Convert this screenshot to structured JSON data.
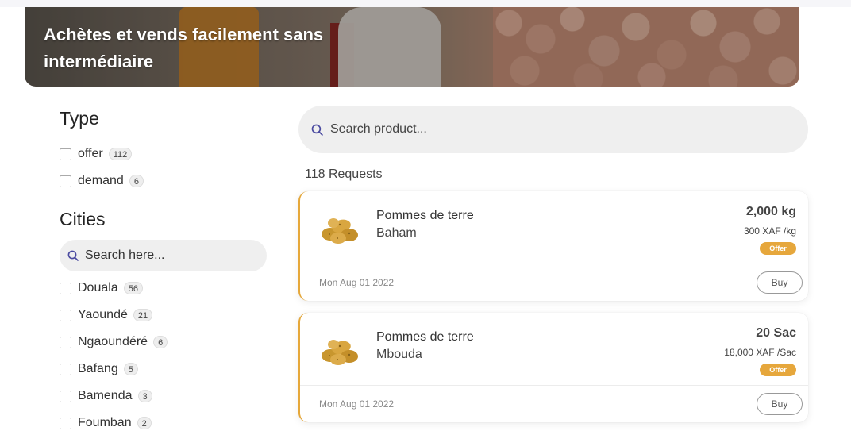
{
  "banner": {
    "title": "Achètes et vends facilement sans intermédiaire"
  },
  "search": {
    "placeholder": "Search product..."
  },
  "filters": {
    "type": {
      "title": "Type",
      "options": [
        {
          "label": "offer",
          "count": "112"
        },
        {
          "label": "demand",
          "count": "6"
        }
      ]
    },
    "cities": {
      "title": "Cities",
      "search_placeholder": "Search here...",
      "options": [
        {
          "label": "Douala",
          "count": "56"
        },
        {
          "label": "Yaoundé",
          "count": "21"
        },
        {
          "label": "Ngaoundéré",
          "count": "6"
        },
        {
          "label": "Bafang",
          "count": "5"
        },
        {
          "label": "Bamenda",
          "count": "3"
        },
        {
          "label": "Foumban",
          "count": "2"
        }
      ]
    }
  },
  "results": {
    "count_label": "118 Requests",
    "items": [
      {
        "product": "Pommes de terre",
        "city": "Baham",
        "quantity": "2,000 kg",
        "price": "300 XAF /kg",
        "badge": "Offer",
        "date": "Mon Aug 01 2022",
        "action": "Buy"
      },
      {
        "product": "Pommes de terre",
        "city": "Mbouda",
        "quantity": "20 Sac",
        "price": "18,000 XAF /Sac",
        "badge": "Offer",
        "date": "Mon Aug 01 2022",
        "action": "Buy"
      }
    ]
  },
  "colors": {
    "accent": "#e6a73c",
    "search_bg": "#efefef",
    "search_icon": "#4a4aa0"
  },
  "icons": {
    "search": "search-icon",
    "product": "potato-image"
  }
}
